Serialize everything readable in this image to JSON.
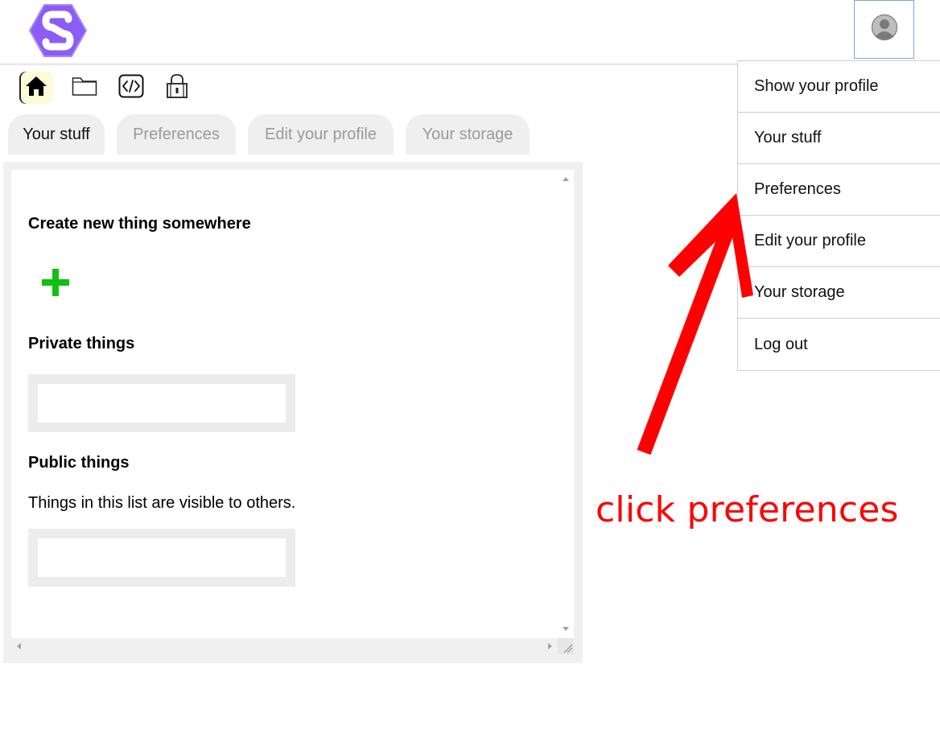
{
  "header": {
    "logo_icon": "hexagon-s-logo",
    "logo_color": "#8b5cf6",
    "avatar_icon": "user-avatar-icon"
  },
  "icon_toolbar": [
    {
      "icon": "home-icon",
      "active": true
    },
    {
      "icon": "folder-icon",
      "active": false
    },
    {
      "icon": "code-icon",
      "active": false
    },
    {
      "icon": "lock-icon",
      "active": false
    }
  ],
  "tabs": [
    {
      "label": "Your stuff",
      "active": true
    },
    {
      "label": "Preferences",
      "active": false
    },
    {
      "label": "Edit your profile",
      "active": false
    },
    {
      "label": "Your storage",
      "active": false
    }
  ],
  "main": {
    "create_heading": "Create new thing somewhere",
    "add_icon": "plus-icon",
    "add_color": "#12c012",
    "private_heading": "Private things",
    "public_heading": "Public things",
    "public_note": "Things in this list are visible to others."
  },
  "user_menu": {
    "items": [
      "Show your profile",
      "Your stuff",
      "Preferences",
      "Edit your profile",
      "Your storage",
      "Log out"
    ]
  },
  "annotation": {
    "text": "click preferences",
    "color": "#ff0000"
  }
}
